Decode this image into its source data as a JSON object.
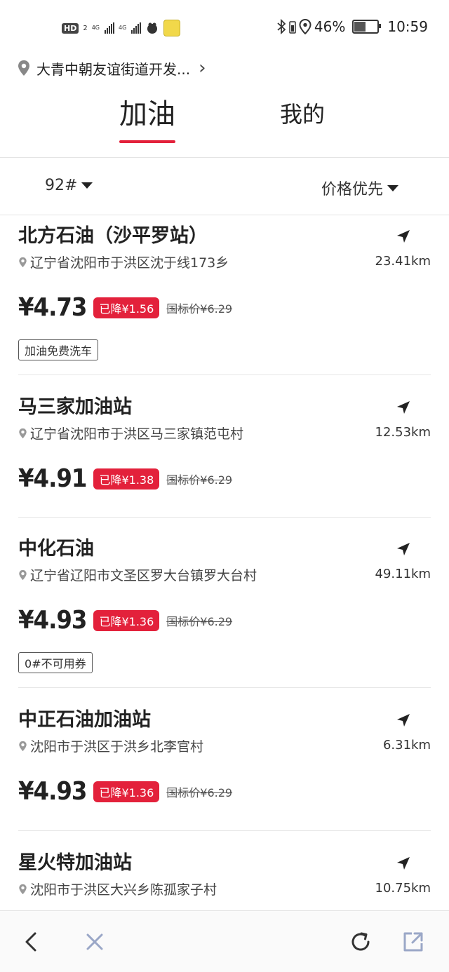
{
  "status_bar": {
    "hd": "HD",
    "sim": "2",
    "net1": "4G",
    "net2": "4G",
    "battery": "46%",
    "time": "10:59"
  },
  "location": {
    "text": "大青中朝友谊街道开发...",
    "chevron": "›"
  },
  "tabs": {
    "active": "加油",
    "other": "我的"
  },
  "filters": {
    "fuel": "92#",
    "sort": "价格优先"
  },
  "stations": [
    {
      "name": "北方石油（沙平罗站）",
      "address": "辽宁省沈阳市于洪区沈于线173乡",
      "distance": "23.41km",
      "price": "¥4.73",
      "drop": "已降¥1.56",
      "national": "国标价¥6.29",
      "tag": "加油免费洗车"
    },
    {
      "name": "马三家加油站",
      "address": "辽宁省沈阳市于洪区马三家镇范屯村",
      "distance": "12.53km",
      "price": "¥4.91",
      "drop": "已降¥1.38",
      "national": "国标价¥6.29"
    },
    {
      "name": "中化石油",
      "address": "辽宁省辽阳市文圣区罗大台镇罗大台村",
      "distance": "49.11km",
      "price": "¥4.93",
      "drop": "已降¥1.36",
      "national": "国标价¥6.29",
      "tag": "0#不可用券"
    },
    {
      "name": "中正石油加油站",
      "address": "沈阳市于洪区于洪乡北李官村",
      "distance": "6.31km",
      "price": "¥4.93",
      "drop": "已降¥1.36",
      "national": "国标价¥6.29"
    },
    {
      "name": "星火特加油站",
      "address": "沈阳市于洪区大兴乡陈孤家子村",
      "distance": "10.75km"
    }
  ],
  "colors": {
    "accent": "#e3213b",
    "text": "#222222"
  },
  "icons": {
    "location": "map-pin-icon",
    "navigate": "navigation-arrow-icon",
    "back": "back-chevron-icon",
    "close": "close-icon",
    "refresh": "refresh-icon",
    "share": "share-external-icon"
  }
}
